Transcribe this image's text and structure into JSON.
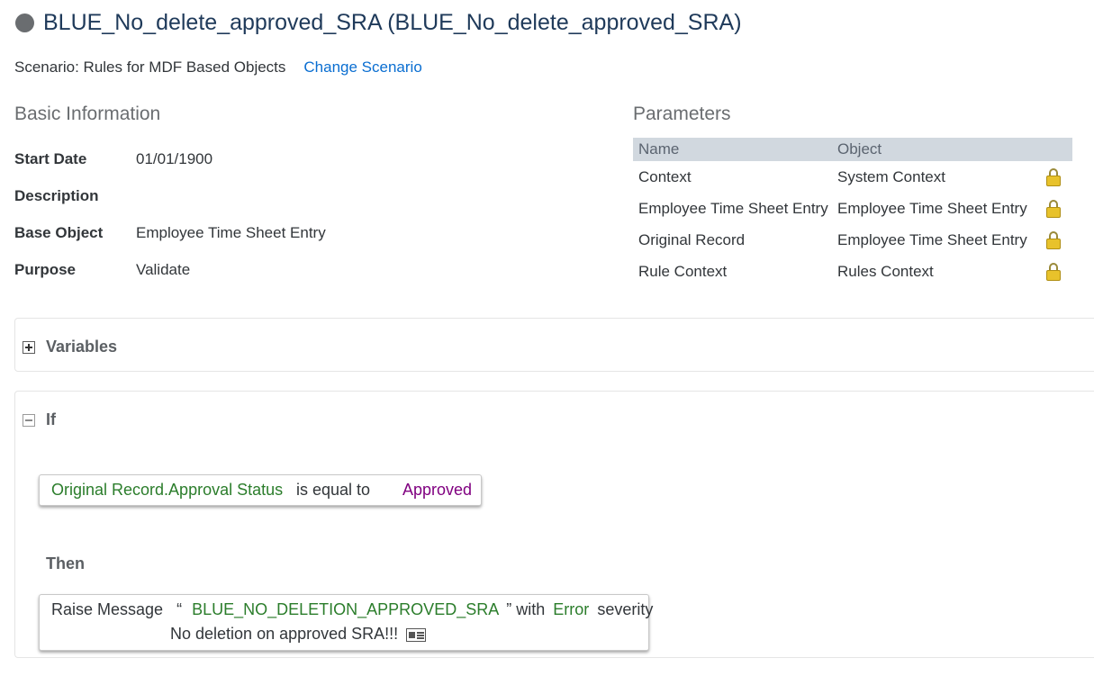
{
  "header": {
    "title": "BLUE_No_delete_approved_SRA (BLUE_No_delete_approved_SRA)",
    "status_color": "#6a6d70"
  },
  "scenario": {
    "text": "Scenario: Rules for MDF Based Objects",
    "change_link": "Change Scenario"
  },
  "basic_info": {
    "title": "Basic Information",
    "fields": [
      {
        "label": "Start Date",
        "value": "01/01/1900"
      },
      {
        "label": "Description",
        "value": ""
      },
      {
        "label": "Base Object",
        "value": "Employee Time Sheet Entry"
      },
      {
        "label": "Purpose",
        "value": "Validate"
      }
    ]
  },
  "parameters": {
    "title": "Parameters",
    "columns": [
      "Name",
      "Object"
    ],
    "rows": [
      {
        "name": "Context",
        "object": "System Context",
        "icon": "lock-icon"
      },
      {
        "name": "Employee Time Sheet Entry",
        "object": "Employee Time Sheet Entry",
        "icon": "lock-icon"
      },
      {
        "name": "Original Record",
        "object": "Employee Time Sheet Entry",
        "icon": "lock-icon"
      },
      {
        "name": "Rule Context",
        "object": "Rules Context",
        "icon": "lock-icon"
      }
    ]
  },
  "variables": {
    "label": "Variables",
    "icon": "expand-plus-icon"
  },
  "if_section": {
    "label": "If",
    "icon": "collapse-minus-icon",
    "condition": {
      "field": "Original Record.Approval Status",
      "operator": "is equal to",
      "value": "Approved"
    },
    "then_label": "Then",
    "action": {
      "prefix": "Raise Message",
      "open_quote": "“",
      "message_key": "BLUE_NO_DELETION_APPROVED_SRA",
      "close_quote": "”",
      "with_text": "with",
      "severity": "Error",
      "severity_suffix": "severity",
      "message_text": "No deletion on approved SRA!!!",
      "message_icon": "message-details-icon"
    }
  },
  "colors": {
    "field_green": "#2b7d2b",
    "value_purple": "#800080",
    "link_blue": "#0a6ed1"
  }
}
